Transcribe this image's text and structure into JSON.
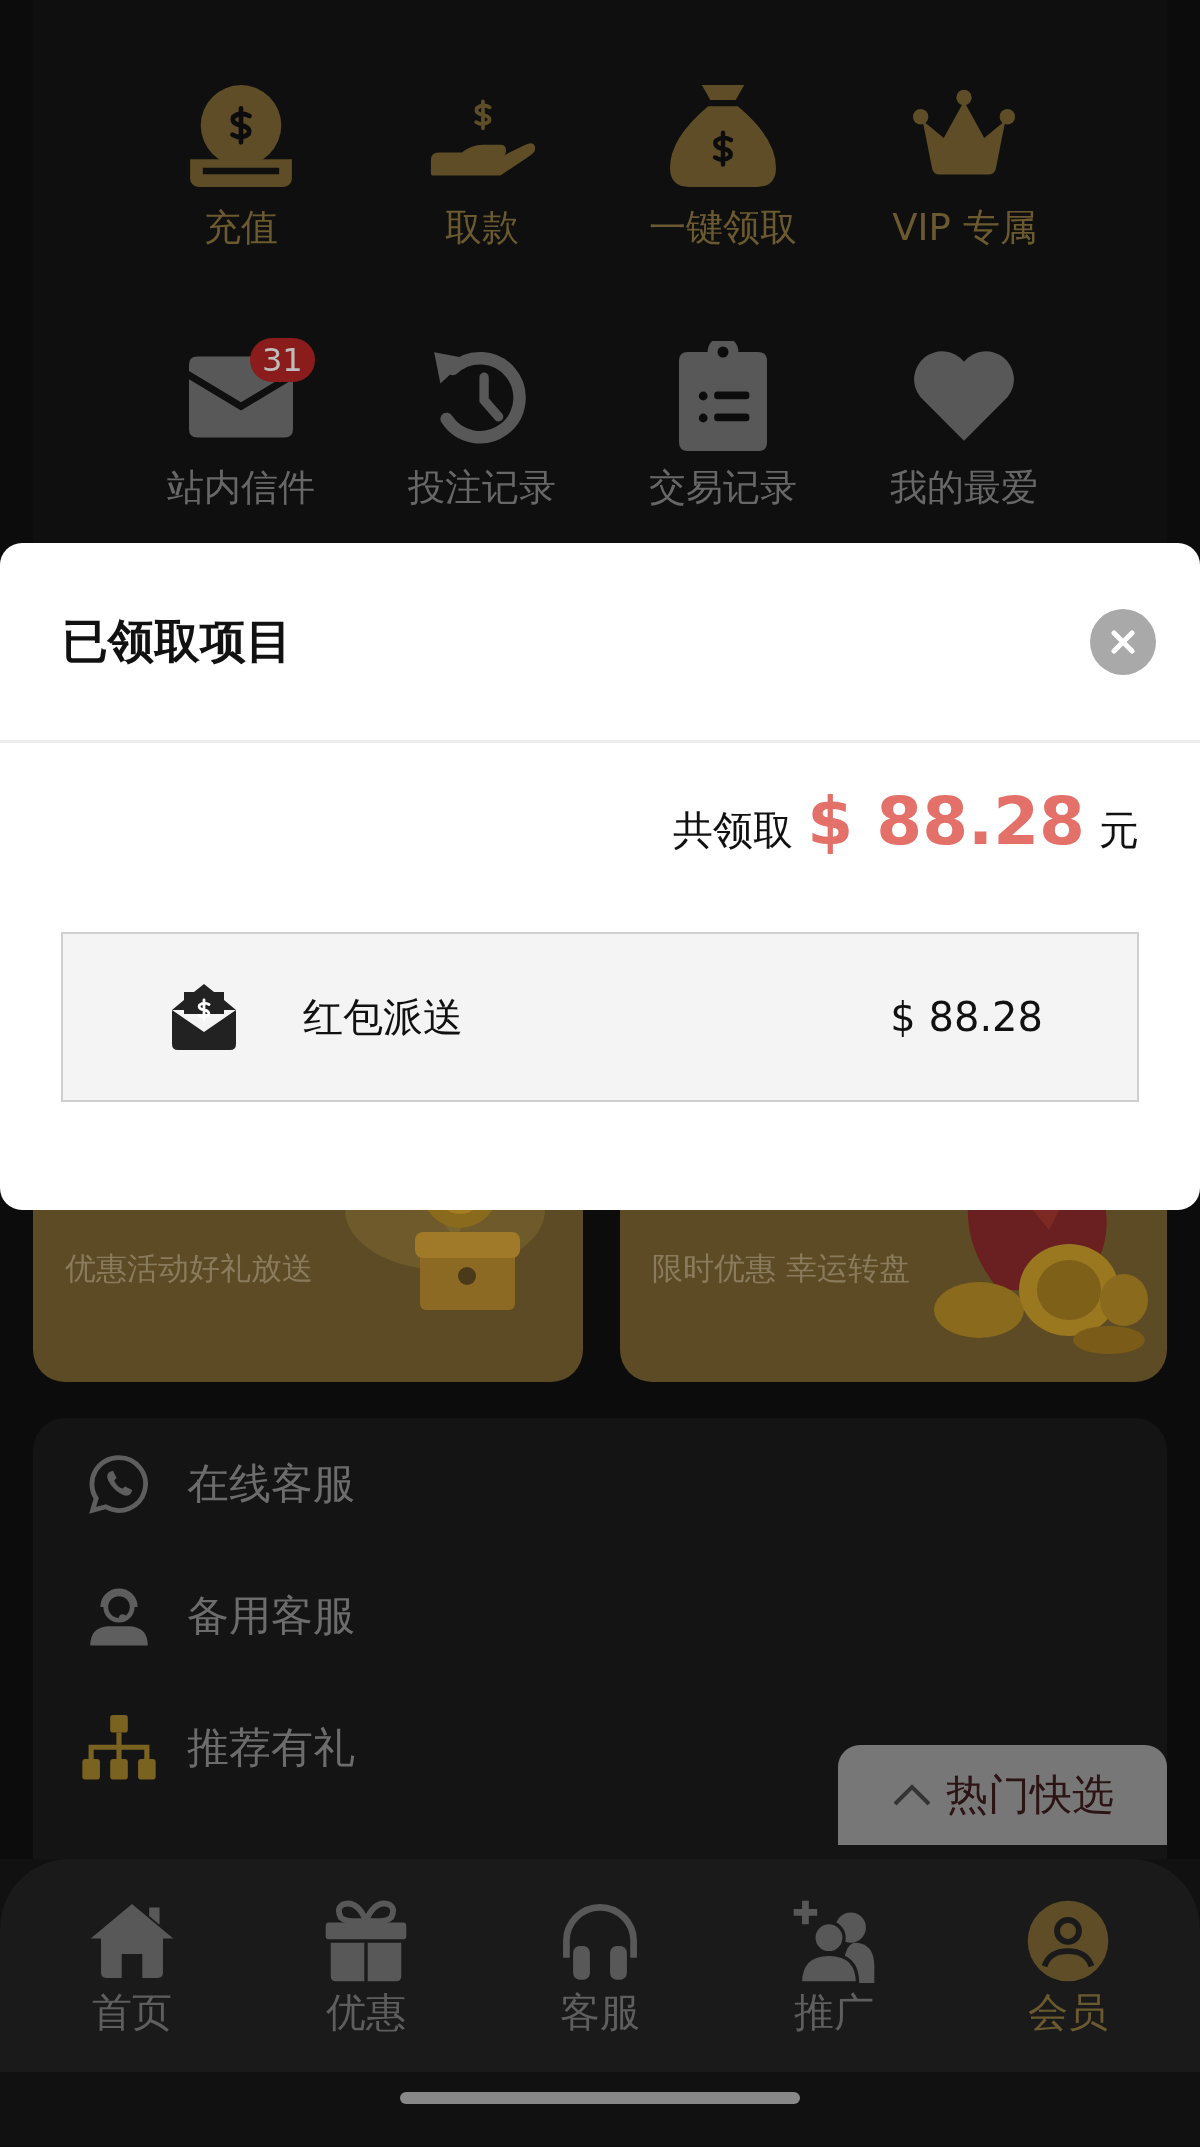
{
  "quick_actions": [
    {
      "label": "充值",
      "kind": "featured"
    },
    {
      "label": "取款",
      "kind": "featured"
    },
    {
      "label": "一键领取",
      "kind": "featured"
    },
    {
      "label": "VIP 专属",
      "kind": "featured"
    },
    {
      "label": "站内信件",
      "kind": "plain",
      "badge": "31"
    },
    {
      "label": "投注记录",
      "kind": "plain"
    },
    {
      "label": "交易记录",
      "kind": "plain"
    },
    {
      "label": "我的最爱",
      "kind": "plain"
    }
  ],
  "claim_modal": {
    "title": "已领取项目",
    "total_label": "共领取",
    "total_amount": "$ 88.28",
    "total_unit": "元",
    "items": [
      {
        "name": "红包派送",
        "amount": "$ 88.28"
      }
    ]
  },
  "promo_cards": [
    {
      "subtitle": "优惠活动好礼放送"
    },
    {
      "subtitle": "限时优惠 幸运转盘"
    }
  ],
  "service_links": [
    {
      "label": "在线客服"
    },
    {
      "label": "备用客服"
    },
    {
      "label": "推荐有礼"
    }
  ],
  "floating_button": {
    "label": "热门快选"
  },
  "tab_bar": [
    {
      "label": "首页",
      "selected": false
    },
    {
      "label": "优惠",
      "selected": false
    },
    {
      "label": "客服",
      "selected": false
    },
    {
      "label": "推广",
      "selected": false
    },
    {
      "label": "会员",
      "selected": true
    }
  ]
}
